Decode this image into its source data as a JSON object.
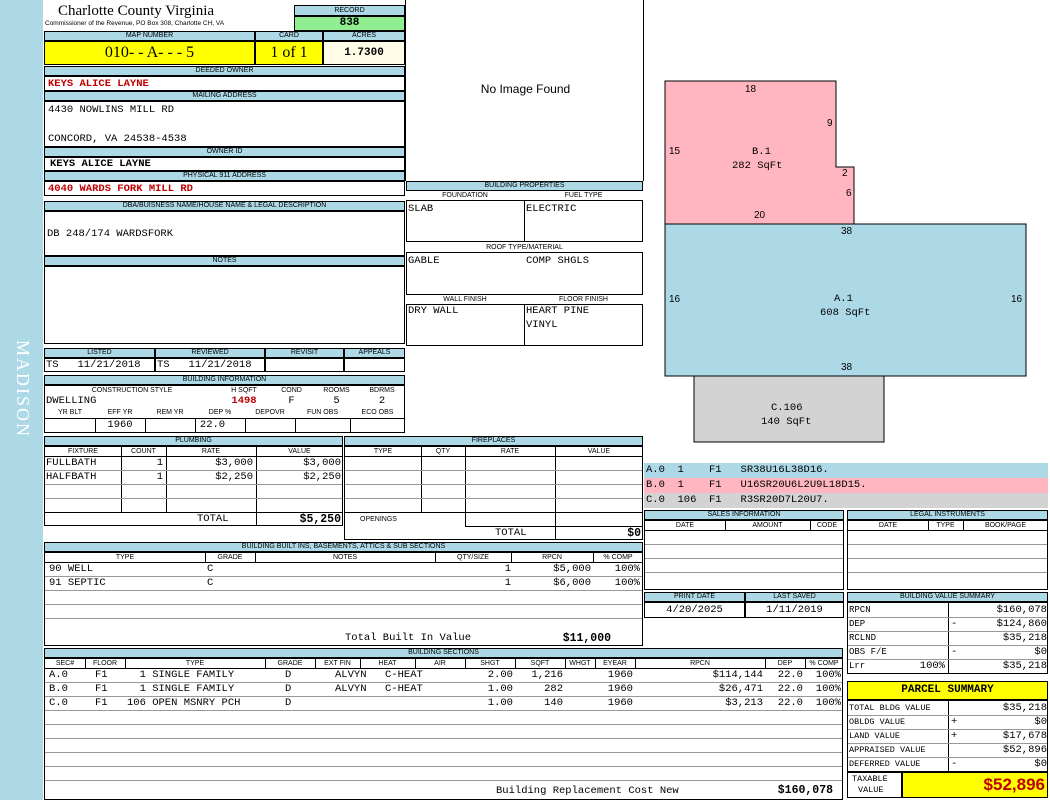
{
  "county": {
    "name": "Charlotte County Virginia",
    "sub": "Commissioner of the Revenue, PO Box 308, Charlotte CH, VA"
  },
  "sidebar": {
    "label": "MADISON"
  },
  "record": {
    "label": "RECORD",
    "value": "838"
  },
  "map": {
    "label": "MAP NUMBER",
    "value": "010- - A- - - 5",
    "card_label": "CARD",
    "card": "1 of 1",
    "acres_label": "ACRES",
    "acres": "1.7300"
  },
  "owner": {
    "deeded_label": "DEEDED OWNER",
    "deeded": "KEYS ALICE LAYNE",
    "mailing_label": "MAILING ADDRESS",
    "mailing1": "4430 NOWLINS MILL RD",
    "mailing2": "CONCORD, VA 24538-4538",
    "id_label": "OWNER ID",
    "id": "KEYS ALICE LAYNE",
    "p911_label": "PHYSICAL 911 ADDRESS",
    "p911": "4040 WARDS FORK MILL RD",
    "dba_label": "DBA/BUISNESS NAME/HOUSE NAME & LEGAL DESCRIPTION",
    "dba": "DB 248/174 WARDSFORK",
    "notes_label": "NOTES"
  },
  "image": {
    "no_image": "No Image Found"
  },
  "status": {
    "listed_label": "LISTED",
    "listed": "TS   11/21/2018",
    "reviewed_label": "REVIEWED",
    "reviewed": "TS   11/21/2018",
    "revisit_label": "REVISIT",
    "appeals_label": "APPEALS"
  },
  "building_info": {
    "title": "BUILDING INFORMATION",
    "h_style": "CONSTRUCTION STYLE",
    "h_sqft": "H SQFT",
    "h_cond": "COND",
    "h_rooms": "ROOMS",
    "h_bdrms": "BDRMS",
    "style": "DWELLING",
    "sqft": "1498",
    "cond": "F",
    "rooms": "5",
    "bdrms": "2",
    "h_yrblt": "YR BLT",
    "h_effyr": "EFF YR",
    "h_remyr": "REM YR",
    "h_dep": "DEP %",
    "h_depovr": "DEPOVR",
    "h_funobs": "FUN OBS",
    "h_ecoobs": "ECO OBS",
    "effyr": "1960",
    "dep": "22.0"
  },
  "building_props": {
    "title": "BUILDING PROPERTIES",
    "foundation_label": "FOUNDATION",
    "foundation": "SLAB",
    "fuel_label": "FUEL TYPE",
    "fuel": "ELECTRIC",
    "roof_label": "ROOF TYPE/MATERIAL",
    "roof1": "GABLE",
    "roof2": "COMP SHGLS",
    "wall_label": "WALL FINISH",
    "wall": "DRY WALL",
    "floor_label": "FLOOR FINISH",
    "floor1": "HEART PINE",
    "floor2": "VINYL"
  },
  "plumbing": {
    "title": "PLUMBING",
    "headers": [
      "FIXTURE",
      "COUNT",
      "RATE",
      "VALUE"
    ],
    "rows": [
      {
        "fixture": "FULLBATH",
        "count": "1",
        "rate": "$3,000",
        "value": "$3,000"
      },
      {
        "fixture": "HALFBATH",
        "count": "1",
        "rate": "$2,250",
        "value": "$2,250"
      }
    ],
    "total_label": "TOTAL",
    "total": "$5,250"
  },
  "fireplaces": {
    "title": "FIREPLACES",
    "headers": [
      "TYPE",
      "QTY",
      "RATE",
      "VALUE"
    ],
    "openings_label": "OPENINGS",
    "total_label": "TOTAL",
    "total": "$0"
  },
  "sketch": {
    "sections": [
      {
        "name": "B.1",
        "area": "282 SqFt",
        "color": "#ffb6c1"
      },
      {
        "name": "A.1",
        "area": "608 SqFt",
        "color": "#add8e6"
      },
      {
        "name": "C.106",
        "area": "140 SqFt",
        "color": "#d3d3d3"
      }
    ],
    "dims": {
      "b_top": "18",
      "b_right_top": "9",
      "b_left": "15",
      "b_step": "2",
      "b_right_low": "6",
      "b_bottom": "20",
      "a_top": "38",
      "a_left": "16",
      "a_right": "16",
      "a_bottom": "38"
    },
    "codes": [
      {
        "text": "A.0  1    F1   SR38U16L38D16.",
        "color": "#add8e6"
      },
      {
        "text": "B.0  1    F1   U16SR20U6L2U9L18D15.",
        "color": "#ffb6c1"
      },
      {
        "text": "C.0  106  F1   R3SR20D7L20U7.",
        "color": "#d3d3d3"
      }
    ]
  },
  "sales": {
    "title": "SALES INFORMATION",
    "headers": [
      "DATE",
      "AMOUNT",
      "CODE"
    ]
  },
  "legal": {
    "title": "LEGAL INSTRUMENTS",
    "headers": [
      "DATE",
      "TYPE",
      "BOOK/PAGE"
    ]
  },
  "builtins": {
    "title": "BUILDING BUILT INS, BASEMENTS, ATTICS & SUB SECTIONS",
    "headers": [
      "TYPE",
      "GRADE",
      "NOTES",
      "QTY/SIZE",
      "RPCN",
      "% COMP"
    ],
    "rows": [
      {
        "type": "90 WELL",
        "grade": "C",
        "qty": "1",
        "rpcn": "$5,000",
        "comp": "100%"
      },
      {
        "type": "91 SEPTIC",
        "grade": "C",
        "qty": "1",
        "rpcn": "$6,000",
        "comp": "100%"
      }
    ],
    "total_label": "Total Built In Value",
    "total": "$11,000"
  },
  "dates": {
    "print_label": "PRINT DATE",
    "print": "4/20/2025",
    "saved_label": "LAST SAVED",
    "saved": "1/11/2019"
  },
  "value_summary": {
    "title": "BUILDING VALUE SUMMARY",
    "rows": [
      {
        "label": "RPCN",
        "sign": "",
        "pct": "",
        "value": "$160,078"
      },
      {
        "label": "DEP",
        "sign": "-",
        "pct": "",
        "value": "$124,860"
      },
      {
        "label": "RCLND",
        "sign": "",
        "pct": "",
        "value": "$35,218"
      },
      {
        "label": "OBS F/E",
        "sign": "-",
        "pct": "",
        "value": "$0"
      },
      {
        "label": "Lrr",
        "sign": "",
        "pct": "100%",
        "value": "$35,218"
      }
    ]
  },
  "parcel": {
    "title": "PARCEL SUMMARY",
    "rows": [
      {
        "label": "TOTAL BLDG VALUE",
        "sign": "",
        "value": "$35,218"
      },
      {
        "label": "OBLDG VALUE",
        "sign": "+",
        "value": "$0"
      },
      {
        "label": "LAND VALUE",
        "sign": "+",
        "value": "$17,678"
      },
      {
        "label": "APPRAISED VALUE",
        "sign": "",
        "value": "$52,896"
      },
      {
        "label": "DEFERRED VALUE",
        "sign": "-",
        "value": "$0"
      }
    ],
    "taxable_label1": "TAXABLE",
    "taxable_label2": "VALUE",
    "taxable": "$52,896"
  },
  "sections": {
    "title": "BUILDING SECTIONS",
    "headers": [
      "SEC#",
      "FLOOR",
      "TYPE",
      "GRADE",
      "EXT FIN",
      "HEAT",
      "AIR",
      "SHGT",
      "SQFT",
      "WHGT",
      "EYEAR",
      "RPCN",
      "DEP",
      "% COMP"
    ],
    "rows": [
      {
        "sec": "A.0",
        "floor": "F1",
        "type": "  1 SINGLE FAMILY",
        "grade": "D",
        "ext": "ALVYN",
        "heat": "C-HEAT",
        "shgt": "2.00",
        "sqft": "1,216",
        "eyear": "1960",
        "rpcn": "$114,144",
        "dep": "22.0",
        "comp": "100%"
      },
      {
        "sec": "B.0",
        "floor": "F1",
        "type": "  1 SINGLE FAMILY",
        "grade": "D",
        "ext": "ALVYN",
        "heat": "C-HEAT",
        "shgt": "1.00",
        "sqft": "282",
        "eyear": "1960",
        "rpcn": "$26,471",
        "dep": "22.0",
        "comp": "100%"
      },
      {
        "sec": "C.0",
        "floor": "F1",
        "type": "106 OPEN MSNRY PCH",
        "grade": "D",
        "ext": "",
        "heat": "",
        "shgt": "1.00",
        "sqft": "140",
        "eyear": "1960",
        "rpcn": "$3,213",
        "dep": "22.0",
        "comp": "100%"
      }
    ],
    "brcn_label": "Building Replacement Cost New",
    "brcn": "$160,078"
  }
}
